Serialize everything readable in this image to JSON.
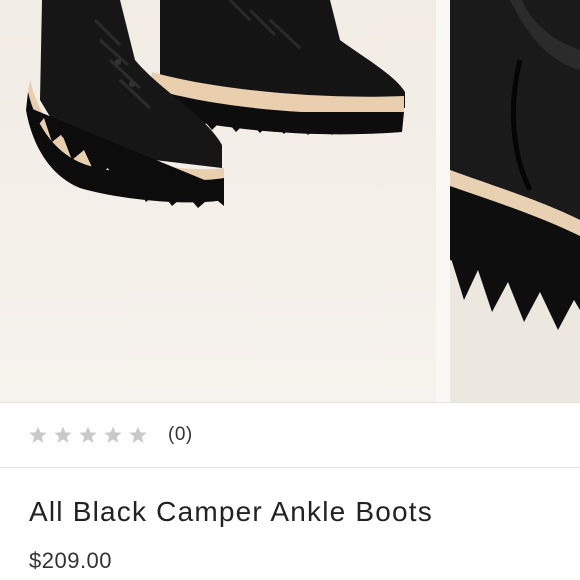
{
  "product": {
    "title": "All Black Camper Ankle Boots",
    "price": "$209.00"
  },
  "rating": {
    "stars_filled": 0,
    "stars_total": 5,
    "review_count_text": "(0)"
  },
  "colors": {
    "star_empty": "#c9c9c9",
    "boot_black": "#151515",
    "sole_stripe": "#e9cfae",
    "background": "#f6f2ec"
  },
  "gallery": {
    "images": [
      {
        "icon": "boots-photo-icon"
      },
      {
        "icon": "boot-closeup-photo-icon"
      }
    ]
  }
}
